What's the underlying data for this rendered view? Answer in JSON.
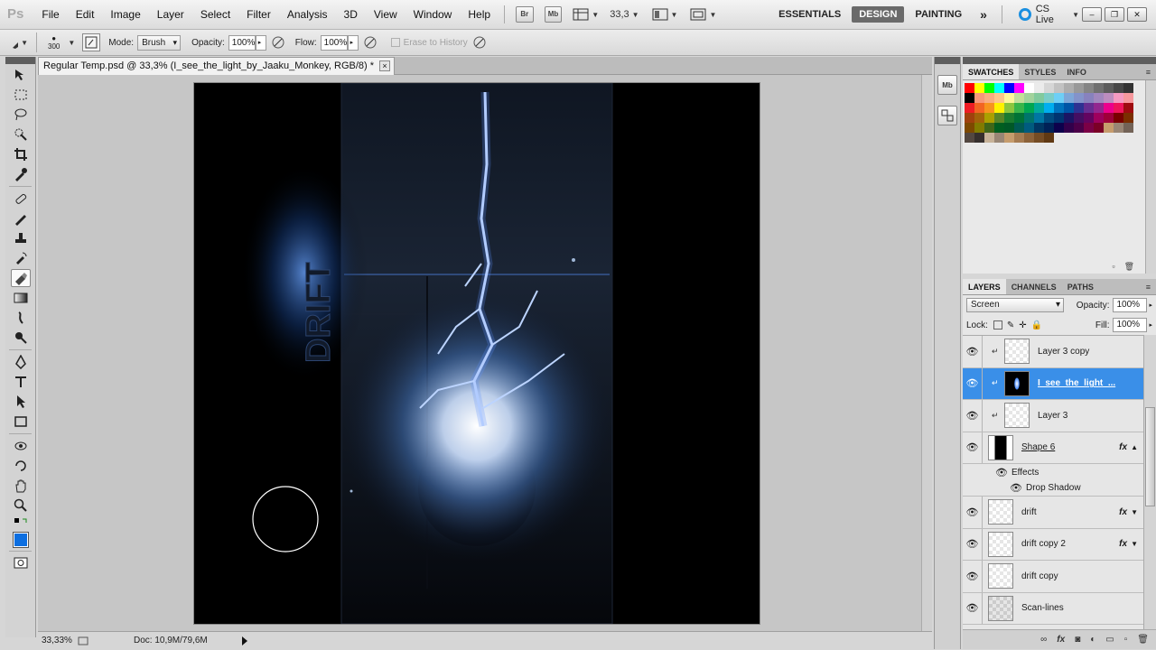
{
  "app": {
    "logo": "Ps"
  },
  "menubar": {
    "items": [
      "File",
      "Edit",
      "Image",
      "Layer",
      "Select",
      "Filter",
      "Analysis",
      "3D",
      "View",
      "Window",
      "Help"
    ],
    "bridge_label": "Br",
    "minibridge_label": "Mb",
    "zoom": "33,3",
    "workspaces": [
      "ESSENTIALS",
      "DESIGN",
      "PAINTING"
    ],
    "active_workspace": "DESIGN",
    "more": "»",
    "cslive": "CS Live"
  },
  "options": {
    "brush_size": "300",
    "mode_label": "Mode:",
    "mode_value": "Brush",
    "opacity_label": "Opacity:",
    "opacity_value": "100%",
    "flow_label": "Flow:",
    "flow_value": "100%",
    "erase_history": "Erase to History"
  },
  "document": {
    "tab_title": "Regular Temp.psd @ 33,3% (I_see_the_light_by_Jaaku_Monkey, RGB/8) *",
    "close": "×",
    "canvas_text": "DRIFT"
  },
  "status": {
    "zoom": "33,33%",
    "doc": "Doc: 10,9M/79,6M"
  },
  "side_icons": {
    "minibridge": "Mb"
  },
  "swatches_panel": {
    "tabs": [
      "SWATCHES",
      "STYLES",
      "INFO"
    ],
    "colors": [
      "#ff0000",
      "#ffff00",
      "#00ff00",
      "#00ffff",
      "#0000ff",
      "#ff00ff",
      "#ffffff",
      "#ebebeb",
      "#d6d6d6",
      "#c2c2c2",
      "#adadad",
      "#999999",
      "#858585",
      "#707070",
      "#5c5c5c",
      "#474747",
      "#333333",
      "#000000",
      "#f7977a",
      "#f9ad81",
      "#fdc68a",
      "#fff79a",
      "#c4df9b",
      "#a2d39c",
      "#82ca9d",
      "#7bcdc8",
      "#6ecff6",
      "#7ea7d8",
      "#8493ca",
      "#8882be",
      "#a187be",
      "#bc8dbf",
      "#f49ac2",
      "#f6989d",
      "#ee1c24",
      "#f26522",
      "#f7941d",
      "#fff200",
      "#8dc63f",
      "#39b54a",
      "#00a651",
      "#00a99d",
      "#00aeef",
      "#0072bc",
      "#0054a6",
      "#2e3192",
      "#662d91",
      "#92278f",
      "#ec008c",
      "#ed145b",
      "#9e0b0f",
      "#a0410d",
      "#a3620a",
      "#aba000",
      "#598527",
      "#1a7b30",
      "#007236",
      "#00746b",
      "#0076a3",
      "#004b80",
      "#003471",
      "#1b1464",
      "#440e62",
      "#630460",
      "#9e005d",
      "#9e0039",
      "#790000",
      "#7b2e00",
      "#7d4900",
      "#827b00",
      "#406618",
      "#005e20",
      "#005826",
      "#005952",
      "#005b7f",
      "#003663",
      "#002157",
      "#0d004c",
      "#32004b",
      "#4b0049",
      "#7b0046",
      "#7a0026",
      "#c69c6d",
      "#998675",
      "#736357",
      "#534741",
      "#362f2d",
      "#c7b299",
      "#998675",
      "#c69c6d",
      "#a67c52",
      "#8c6239",
      "#754c24",
      "#603913"
    ]
  },
  "layers_panel": {
    "tabs": [
      "LAYERS",
      "CHANNELS",
      "PATHS"
    ],
    "blend_mode": "Screen",
    "opacity_label": "Opacity:",
    "opacity_value": "100%",
    "lock_label": "Lock:",
    "fill_label": "Fill:",
    "fill_value": "100%",
    "layers": [
      {
        "name": "Layer 3 copy"
      },
      {
        "name": "I_see_the_light_..."
      },
      {
        "name": "Layer 3"
      },
      {
        "name": "Shape 6",
        "fx": "fx"
      },
      {
        "name": "Effects"
      },
      {
        "name": "Drop Shadow"
      },
      {
        "name": "drift",
        "fx": "fx"
      },
      {
        "name": "drift copy 2",
        "fx": "fx"
      },
      {
        "name": "drift copy"
      },
      {
        "name": "Scan-lines"
      }
    ]
  }
}
